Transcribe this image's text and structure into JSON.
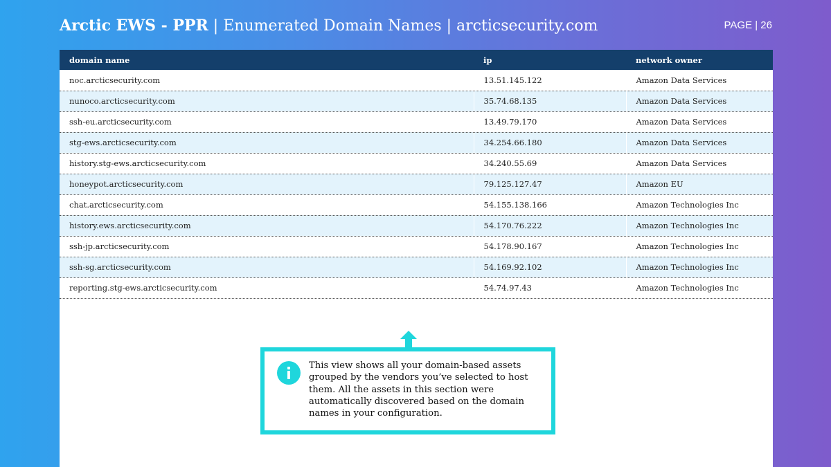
{
  "header": {
    "title_bold": "Arctic EWS - PPR",
    "title_rest": " | Enumerated Domain Names | arcticsecurity.com",
    "page_label": "PAGE | 26"
  },
  "table": {
    "columns": [
      "domain name",
      "ip",
      "network owner"
    ],
    "rows": [
      [
        "noc.arcticsecurity.com",
        "13.51.145.122",
        "Amazon Data Services"
      ],
      [
        "nunoco.arcticsecurity.com",
        "35.74.68.135",
        "Amazon Data Services"
      ],
      [
        "ssh-eu.arcticsecurity.com",
        "13.49.79.170",
        "Amazon Data Services"
      ],
      [
        "stg-ews.arcticsecurity.com",
        "34.254.66.180",
        "Amazon Data Services"
      ],
      [
        "history.stg-ews.arcticsecurity.com",
        "34.240.55.69",
        "Amazon Data Services"
      ],
      [
        "honeypot.arcticsecurity.com",
        "79.125.127.47",
        "Amazon EU"
      ],
      [
        "chat.arcticsecurity.com",
        "54.155.138.166",
        "Amazon Technologies Inc"
      ],
      [
        "history.ews.arcticsecurity.com",
        "54.170.76.222",
        "Amazon Technologies Inc"
      ],
      [
        "ssh-jp.arcticsecurity.com",
        "54.178.90.167",
        "Amazon Technologies Inc"
      ],
      [
        "ssh-sg.arcticsecurity.com",
        "54.169.92.102",
        "Amazon Technologies Inc"
      ],
      [
        "reporting.stg-ews.arcticsecurity.com",
        "54.74.97.43",
        "Amazon Technologies Inc"
      ]
    ]
  },
  "callout": {
    "icon": "info-icon",
    "arrow_icon": "up-arrow-icon",
    "text": "This view shows all your domain-based assets grouped by the vendors you’ve selected to host them. All the assets in this section were automatically discovered based on the domain names in your configuration."
  },
  "colors": {
    "header_row": "#143f6b",
    "stripe": "#e3f3fc",
    "accent": "#1fd6dc",
    "gradient_start": "#2fa3ee",
    "gradient_end": "#7e5ccc"
  }
}
